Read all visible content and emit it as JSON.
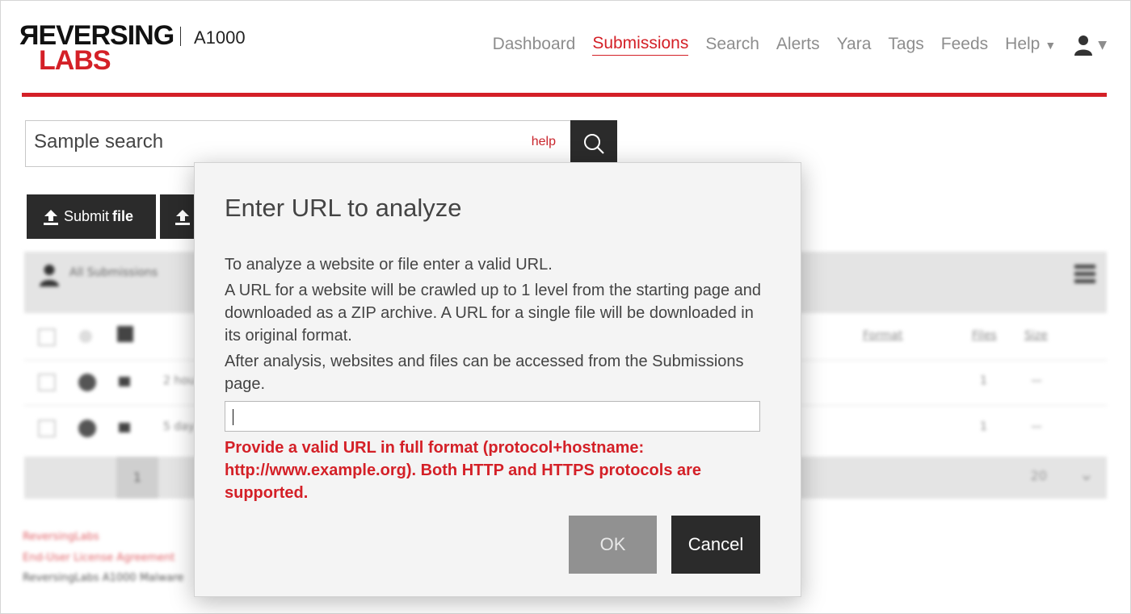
{
  "header": {
    "logo_top": "ЯEVERSING",
    "logo_bottom": "LABS",
    "product": "A1000",
    "nav": [
      {
        "label": "Dashboard"
      },
      {
        "label": "Submissions",
        "active": true
      },
      {
        "label": "Search"
      },
      {
        "label": "Alerts"
      },
      {
        "label": "Yara"
      },
      {
        "label": "Tags"
      },
      {
        "label": "Feeds"
      },
      {
        "label": "Help"
      }
    ],
    "accent_color": "#d42027"
  },
  "search": {
    "placeholder": "Sample search",
    "help_label": "help",
    "icon": "search-icon"
  },
  "actions": {
    "submit_file_prefix": "Submit",
    "submit_file_bold": "file"
  },
  "background": {
    "list_title": "All Submissions",
    "columns": {
      "format": "Format",
      "files": "Files",
      "size": "Size"
    },
    "rows": [
      {
        "time": "2 hou",
        "files": "1",
        "size": "—"
      },
      {
        "time": "5 day",
        "files": "1",
        "size": "—"
      }
    ],
    "pager": {
      "page": "1",
      "size": "20"
    },
    "footer": [
      "ReversingLabs",
      "End-User License Agreement",
      "ReversingLabs A1000 Malware"
    ]
  },
  "modal": {
    "title": "Enter URL to analyze",
    "body": [
      "To analyze a website or file enter a valid URL.",
      "A URL for a website will be crawled up to 1 level from the starting page and downloaded as a ZIP archive. A URL for a single file will be downloaded in its original format.",
      "After analysis, websites and files can be accessed from the Submissions page."
    ],
    "url_value": "",
    "error": "Provide a valid URL in full format (protocol+hostname: http://www.example.org). Both HTTP and HTTPS protocols are supported.",
    "ok_label": "OK",
    "cancel_label": "Cancel"
  }
}
